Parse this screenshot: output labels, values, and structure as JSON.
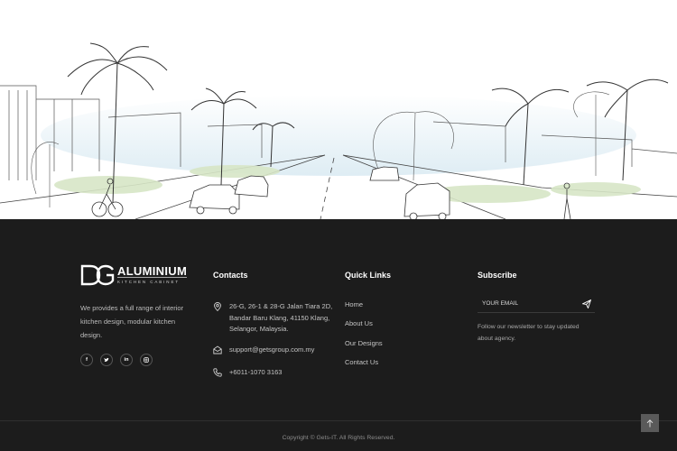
{
  "hero": {
    "alt": "Street landscape sketch illustration"
  },
  "brand": {
    "logo_mark": "DG",
    "logo_main": "ALUMINIUM",
    "logo_sub": "KITCHEN CABINET",
    "description": "We provides a full range of interior kitchen design, modular kitchen design.",
    "socials": [
      {
        "icon": "facebook-icon",
        "glyph": "f"
      },
      {
        "icon": "twitter-icon",
        "glyph": "t"
      },
      {
        "icon": "linkedin-icon",
        "glyph": "in"
      },
      {
        "icon": "instagram-icon",
        "glyph": "◎"
      }
    ]
  },
  "contacts": {
    "title": "Contacts",
    "address": "26-G, 26-1 & 28-G Jalan Tiara 2D, Bandar Baru Klang, 41150 Klang, Selangor, Malaysia.",
    "email": "support@getsgroup.com.my",
    "phone": "+6011-1070 3163"
  },
  "quick_links": {
    "title": "Quick Links",
    "items": [
      "Home",
      "About Us",
      "Our Designs",
      "Contact Us"
    ]
  },
  "subscribe": {
    "title": "Subscribe",
    "placeholder": "YOUR EMAIL",
    "note": "Follow our newsletter to stay updated about agency."
  },
  "footer": {
    "copyright": "Copyright © Gets-IT. All Rights Reserved."
  },
  "colors": {
    "footer_bg": "#1c1c1c",
    "accent_sky": "#cfe3ee",
    "to_top_bg": "#5a5a5a"
  }
}
